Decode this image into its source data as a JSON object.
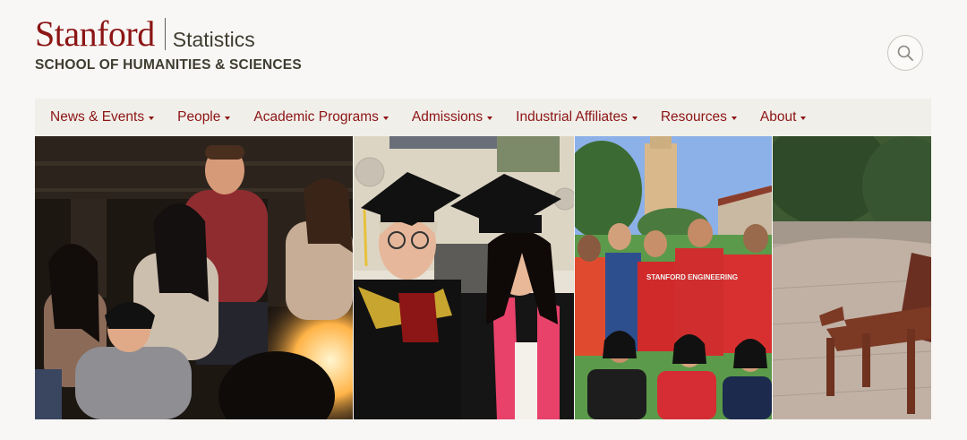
{
  "header": {
    "logo_word": "Stanford",
    "department": "Statistics",
    "school": "SCHOOL OF HUMANITIES & SCIENCES",
    "search_icon": "search-icon"
  },
  "nav": {
    "items": [
      {
        "label": "News & Events",
        "icon": "caret-down-icon"
      },
      {
        "label": "People",
        "icon": "caret-down-icon"
      },
      {
        "label": "Academic Programs",
        "icon": "caret-down-icon"
      },
      {
        "label": "Admissions",
        "icon": "caret-down-icon"
      },
      {
        "label": "Industrial Affiliates",
        "icon": "caret-down-icon"
      },
      {
        "label": "Resources",
        "icon": "caret-down-icon"
      },
      {
        "label": "About",
        "icon": "caret-down-icon"
      }
    ]
  },
  "banner": {
    "photos": [
      {
        "subject": "students-around-campfire"
      },
      {
        "subject": "graduates-in-caps"
      },
      {
        "subject": "group-with-hoover-tower"
      },
      {
        "subject": "campus-bench"
      }
    ],
    "shirt_text": "STANFORD ENGINEERING"
  },
  "colors": {
    "cardinal": "#8c1515",
    "text_dark": "#3f3c30",
    "background": "#f8f7f5",
    "nav_background": "#f1efea"
  }
}
